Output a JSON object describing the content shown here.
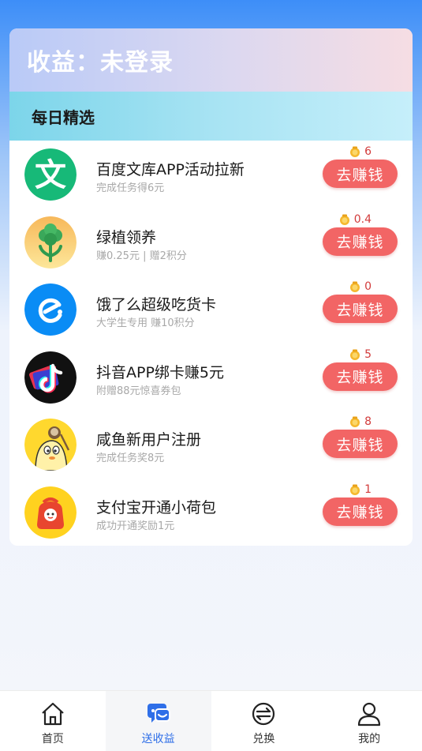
{
  "header": {
    "earnings_title": "收益：未登录"
  },
  "section": {
    "title": "每日精选"
  },
  "button_label": "去赚钱",
  "items": [
    {
      "title": "百度文库APP活动拉新",
      "subtitle": "完成任务得6元",
      "reward": "6",
      "logo": "baidu-wenku-logo"
    },
    {
      "title": "绿植领养",
      "subtitle": "赚0.25元 | 赠2积分",
      "reward": "0.4",
      "logo": "green-plant-logo"
    },
    {
      "title": "饿了么超级吃货卡",
      "subtitle": "大学生专用 赚10积分",
      "reward": "0",
      "logo": "eleme-logo"
    },
    {
      "title": "抖音APP绑卡赚5元",
      "subtitle": "附赠88元惊喜券包",
      "reward": "5",
      "logo": "douyin-logo"
    },
    {
      "title": "咸鱼新用户注册",
      "subtitle": "完成任务奖8元",
      "reward": "8",
      "logo": "xianyu-logo"
    },
    {
      "title": "支付宝开通小荷包",
      "subtitle": "成功开通奖励1元",
      "reward": "1",
      "logo": "alipay-purse-logo"
    }
  ],
  "tabs": [
    {
      "label": "首页",
      "icon": "home-icon",
      "active": false
    },
    {
      "label": "送收益",
      "icon": "chat-gift-icon",
      "active": true
    },
    {
      "label": "兑换",
      "icon": "exchange-icon",
      "active": false
    },
    {
      "label": "我的",
      "icon": "user-icon",
      "active": false
    }
  ],
  "colors": {
    "accent": "#2f6fe8",
    "button": "#f26565",
    "reward": "#d23b3b"
  }
}
